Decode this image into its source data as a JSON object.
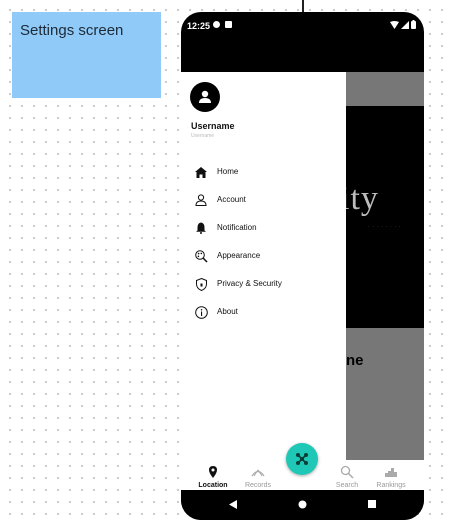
{
  "canvas": {
    "note_title": "Settings screen"
  },
  "status_bar": {
    "time": "12:25"
  },
  "drawer": {
    "username": "Username",
    "username_sub": "Username",
    "items": [
      {
        "label": "Home",
        "icon": "home-icon"
      },
      {
        "label": "Account",
        "icon": "person-icon"
      },
      {
        "label": "Notification",
        "icon": "bell-icon"
      },
      {
        "label": "Appearance",
        "icon": "palette-icon"
      },
      {
        "label": "Privacy & Security",
        "icon": "shield-icon"
      },
      {
        "label": "About",
        "icon": "info-icon"
      }
    ]
  },
  "background_app": {
    "logo_partial": "ity",
    "title_partial": "ne"
  },
  "bottom_nav": {
    "items": [
      {
        "label": "Location",
        "icon": "location-pin-icon",
        "active": true
      },
      {
        "label": "Records",
        "icon": "records-icon",
        "active": false
      },
      {
        "label": "Search",
        "icon": "search-icon",
        "active": false
      },
      {
        "label": "Rankings",
        "icon": "rankings-icon",
        "active": false
      }
    ],
    "fab_icon": "drone-icon"
  },
  "colors": {
    "sticky_note": "#8fcaf9",
    "fab": "#1fc8b6"
  }
}
